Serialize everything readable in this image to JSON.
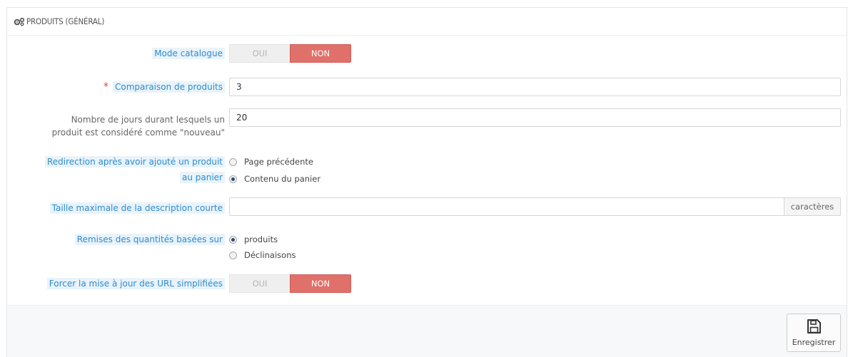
{
  "panel": {
    "title": "PRODUITS (GÉNÉRAL)",
    "icon": "gears-icon"
  },
  "fields": {
    "catalog_mode": {
      "label": "Mode catalogue",
      "yes": "OUI",
      "no": "NON",
      "value": "NON"
    },
    "comparison": {
      "label": "Comparaison de produits",
      "required_mark": "*",
      "value": "3"
    },
    "new_days": {
      "label_line1": "Nombre de jours durant lesquels un",
      "label_line2": "produit est considéré comme \"nouveau\"",
      "value": "20"
    },
    "redirect": {
      "label_line1": "Redirection après avoir ajouté un produit",
      "label_line2": "au panier",
      "options": [
        "Page précédente",
        "Contenu du panier"
      ],
      "selected": "Contenu du panier"
    },
    "short_desc": {
      "label": "Taille maximale de la description courte",
      "value": "",
      "addon": "caractères"
    },
    "qty_discount": {
      "label": "Remises des quantités basées sur",
      "options": [
        "produits",
        "Déclinaisons"
      ],
      "selected": "produits"
    },
    "force_url": {
      "label": "Forcer la mise à jour des URL simplifiées",
      "yes": "OUI",
      "no": "NON",
      "value": "NON"
    }
  },
  "footer": {
    "save_label": "Enregistrer",
    "save_icon": "floppy-disk-icon"
  },
  "colors": {
    "label_blue": "#2e8ccf",
    "label_bg": "#e9f3fa",
    "switch_active": "#e0706a",
    "required": "#e23c3c"
  }
}
